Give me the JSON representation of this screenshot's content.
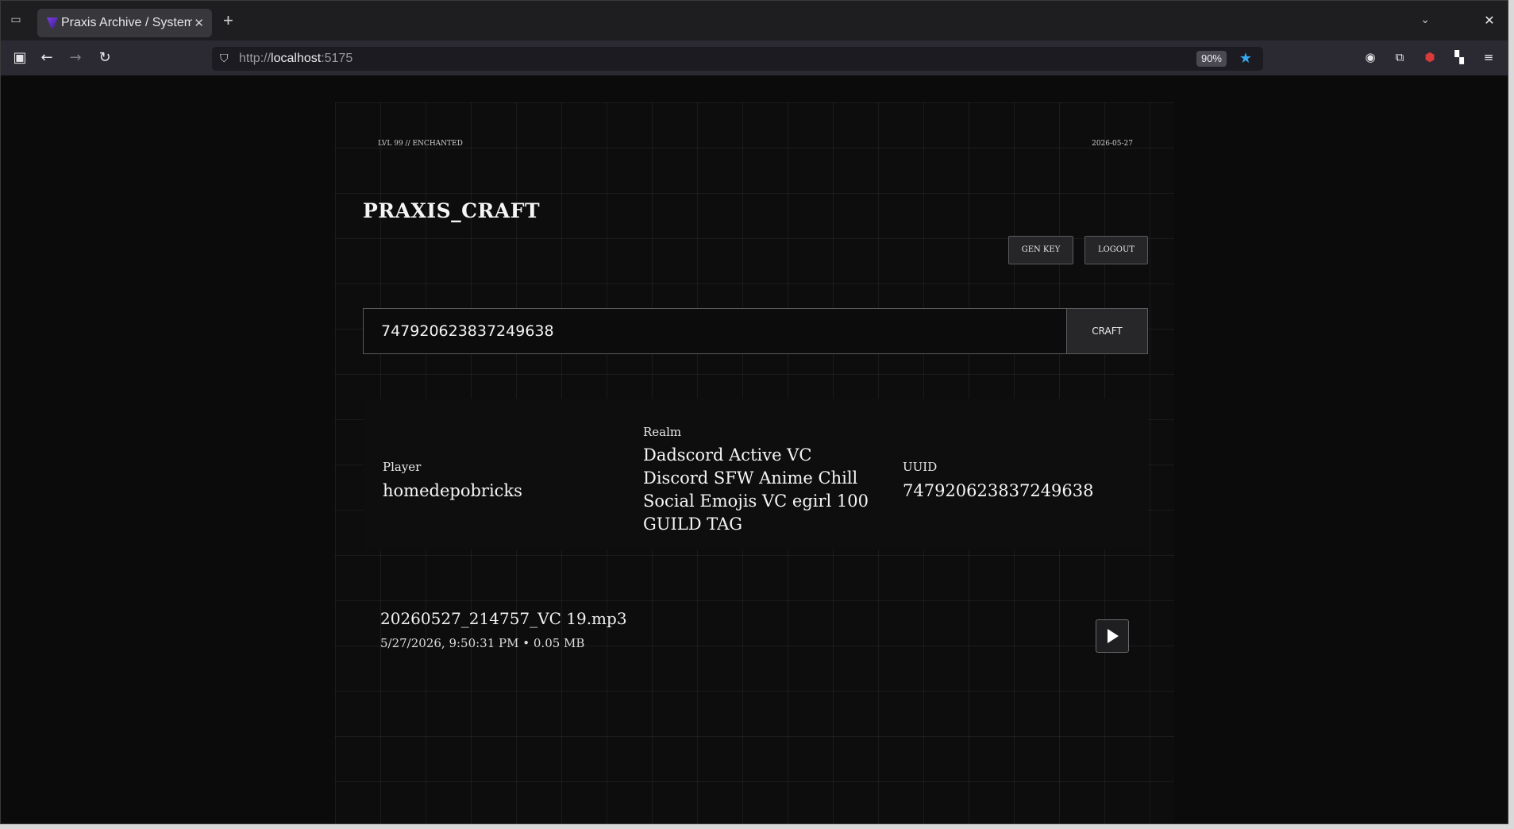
{
  "browser": {
    "tab_title": "Praxis Archive / System",
    "url_protocol": "http://",
    "url_host": "localhost",
    "url_port": ":5175",
    "zoom": "90%"
  },
  "meta": {
    "level": "LVL 99 // ENCHANTED",
    "date": "2026-05-27"
  },
  "header": {
    "brand": "PRAXIS_CRAFT",
    "gen_key_label": "GEN KEY",
    "logout_label": "LOGOUT"
  },
  "search": {
    "value": "747920623837249638",
    "button_label": "CRAFT"
  },
  "player_info": {
    "player_label": "Player",
    "player_value": "homedepobricks",
    "realm_label": "Realm",
    "realm_lines": [
      "Dadscord Active VC",
      "Discord SFW Anime Chill",
      "Social Emojis VC egirl 100",
      "GUILD TAG"
    ],
    "uuid_label": "UUID",
    "uuid_value": "747920623837249638"
  },
  "recording": {
    "file_name": "20260527_214757_VC 19.mp3",
    "file_meta": "5/27/2026, 9:50:31 PM • 0.05 MB"
  }
}
